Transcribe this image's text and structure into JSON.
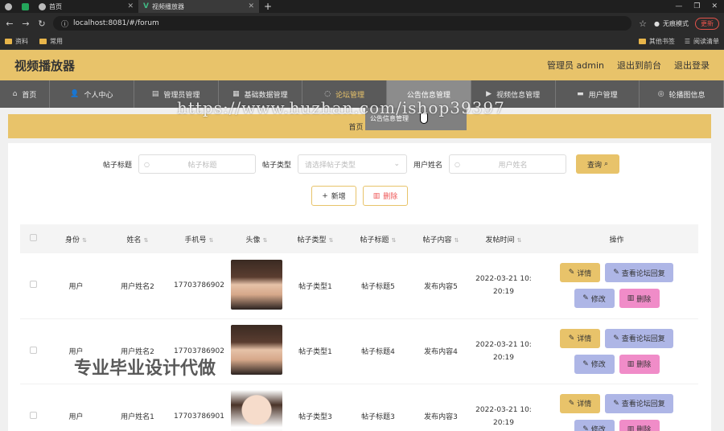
{
  "browser": {
    "tabs": [
      {
        "label": ""
      },
      {
        "label": ""
      },
      {
        "label": "首页"
      },
      {
        "label": "视频播放器"
      }
    ],
    "url": "localhost:8081/#/forum",
    "incognito_label": "无痕模式",
    "update_label": "更新",
    "bookmarks": [
      "资料",
      "常用"
    ],
    "bookmarks_right": [
      "其他书签",
      "阅读清单"
    ]
  },
  "app": {
    "title": "视频播放器",
    "header_links": [
      "管理员 admin",
      "退出到前台",
      "退出登录"
    ]
  },
  "nav": {
    "items": [
      {
        "label": "首页",
        "icon": "home-icon"
      },
      {
        "label": "个人中心",
        "icon": "user-icon"
      },
      {
        "label": "管理员管理",
        "icon": "table-icon"
      },
      {
        "label": "基础数据管理",
        "icon": "grid-icon"
      },
      {
        "label": "论坛管理",
        "icon": "chat-icon"
      },
      {
        "label": "公告信息管理",
        "icon": ""
      },
      {
        "label": "视频信息管理",
        "icon": "video-icon"
      },
      {
        "label": "用户管理",
        "icon": "users-icon"
      },
      {
        "label": "轮播图信息",
        "icon": "image-icon"
      }
    ],
    "dropdown_item": "公告信息管理"
  },
  "breadcrumb": {
    "home": "首页",
    "sep": "/"
  },
  "filters": {
    "title_label": "帖子标题",
    "title_placeholder": "帖子标题",
    "type_label": "帖子类型",
    "type_placeholder": "请选择帖子类型",
    "username_label": "用户姓名",
    "username_placeholder": "用户姓名",
    "search_label": "查询"
  },
  "actions": {
    "add_label": "新增",
    "delete_label": "删除"
  },
  "table": {
    "headers": [
      "身份",
      "姓名",
      "手机号",
      "头像",
      "帖子类型",
      "帖子标题",
      "帖子内容",
      "发帖时间",
      "操作"
    ],
    "rows": [
      {
        "identity": "用户",
        "name": "用户姓名2",
        "phone": "17703786902",
        "avatar": "dark",
        "type": "帖子类型1",
        "title": "帖子标题5",
        "content": "发布内容5",
        "date1": "2022-03-21 10:",
        "date2": "20:19"
      },
      {
        "identity": "用户",
        "name": "用户姓名2",
        "phone": "17703786902",
        "avatar": "dark",
        "type": "帖子类型1",
        "title": "帖子标题4",
        "content": "发布内容4",
        "date1": "2022-03-21 10:",
        "date2": "20:19"
      },
      {
        "identity": "用户",
        "name": "用户姓名1",
        "phone": "17703786901",
        "avatar": "cartoon",
        "type": "帖子类型3",
        "title": "帖子标题3",
        "content": "发布内容3",
        "date1": "2022-03-21 10:",
        "date2": "20:19"
      }
    ],
    "op_labels": {
      "detail": "详情",
      "reply": "查看论坛回复",
      "edit": "修改",
      "remove": "删除"
    }
  },
  "overlays": {
    "watermark_url": "https://www.huzhan.com/ishop39397",
    "watermark_text": "专业毕业设计代做"
  },
  "colors": {
    "accent": "#e8c36a",
    "nav": "#5a5a5a",
    "reply": "#aeb6e6",
    "remove": "#f08cc8"
  }
}
